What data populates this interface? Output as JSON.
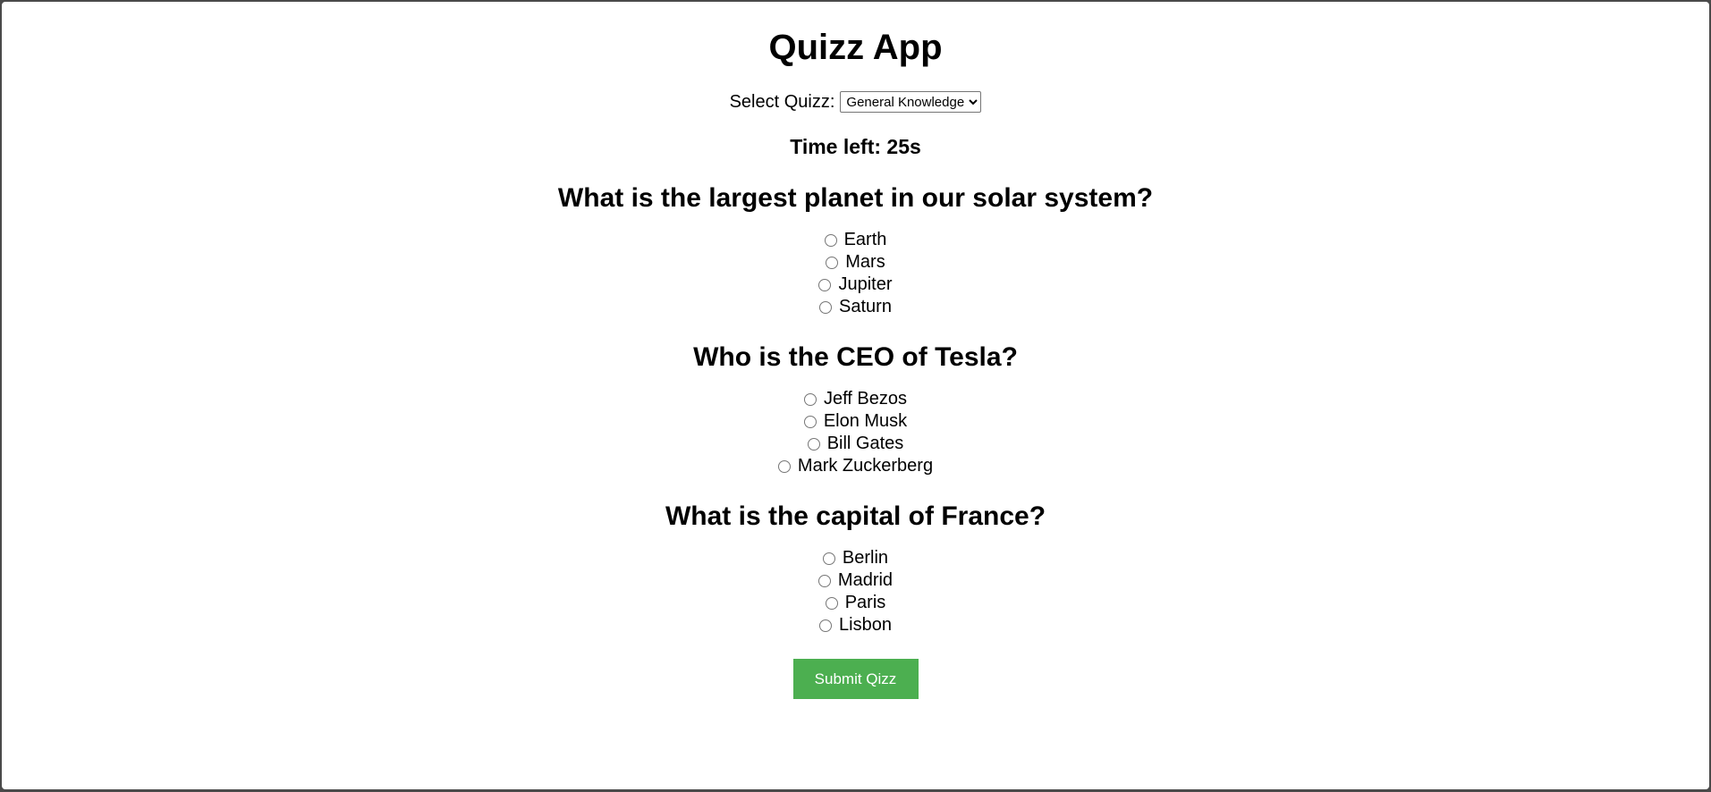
{
  "app": {
    "title": "Quizz App"
  },
  "quiz_select": {
    "label": "Select Quizz:",
    "selected": "General Knowledge",
    "options": [
      "General Knowledge"
    ]
  },
  "timer": {
    "text": "Time left: 25s"
  },
  "questions": [
    {
      "text": "What is the largest planet in our solar system?",
      "options": [
        "Earth",
        "Mars",
        "Jupiter",
        "Saturn"
      ]
    },
    {
      "text": "Who is the CEO of Tesla?",
      "options": [
        "Jeff Bezos",
        "Elon Musk",
        "Bill Gates",
        "Mark Zuckerberg"
      ]
    },
    {
      "text": "What is the capital of France?",
      "options": [
        "Berlin",
        "Madrid",
        "Paris",
        "Lisbon"
      ]
    }
  ],
  "submit": {
    "label": "Submit Qizz"
  },
  "colors": {
    "submit_bg": "#4caf50",
    "submit_text": "#ffffff",
    "page_bg": "#ffffff"
  }
}
